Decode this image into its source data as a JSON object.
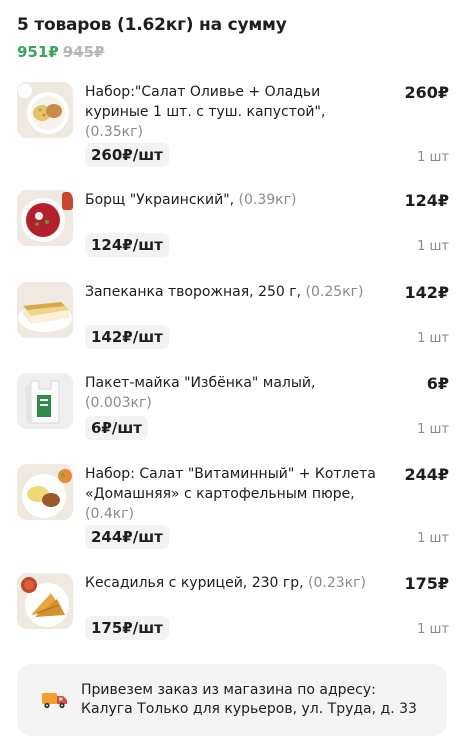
{
  "summary": {
    "title": "5 товаров (1.62кг) на сумму",
    "total_price": "951₽",
    "old_price": "945₽"
  },
  "items": [
    {
      "name": "Набор:\"Салат Оливье + Оладьи куриные 1 шт. с туш. капустой\",",
      "weight": "(0.35кг)",
      "total": "260₽",
      "unit_price": "260₽/шт",
      "qty": "1 шт",
      "icon": "salad-and-pancakes-thumbnail"
    },
    {
      "name": "Борщ \"Украинский\",",
      "weight": "(0.39кг)",
      "total": "124₽",
      "unit_price": "124₽/шт",
      "qty": "1 шт",
      "icon": "borscht-thumbnail"
    },
    {
      "name": "Запеканка творожная, 250 г,",
      "weight": "(0.25кг)",
      "total": "142₽",
      "unit_price": "142₽/шт",
      "qty": "1 шт",
      "icon": "casserole-thumbnail"
    },
    {
      "name": "Пакет-майка \"Избёнка\" малый,",
      "weight": "(0.003кг)",
      "total": "6₽",
      "unit_price": "6₽/шт",
      "qty": "1 шт",
      "icon": "bag-thumbnail"
    },
    {
      "name": "Набор: Салат \"Витаминный\" + Котлета «Домашняя» с картофельным пюре,",
      "weight": "(0.4кг)",
      "total": "244₽",
      "unit_price": "244₽/шт",
      "qty": "1 шт",
      "icon": "cutlet-mash-thumbnail"
    },
    {
      "name": "Кесадилья с курицей, 230 гр,",
      "weight": "(0.23кг)",
      "total": "175₽",
      "unit_price": "175₽/шт",
      "qty": "1 шт",
      "icon": "quesadilla-thumbnail"
    }
  ],
  "delivery": {
    "icon": "delivery-truck-icon",
    "line1": "Привезем заказ из магазина по адресу:",
    "line2": "Калуга Только для курьеров, ул. Труда, д. 33"
  },
  "colors": {
    "accent_green": "#3ba35a",
    "muted_gray": "#8a8a8a",
    "strike_gray": "#b8b8b8",
    "chip_bg": "#f3f3f3"
  }
}
